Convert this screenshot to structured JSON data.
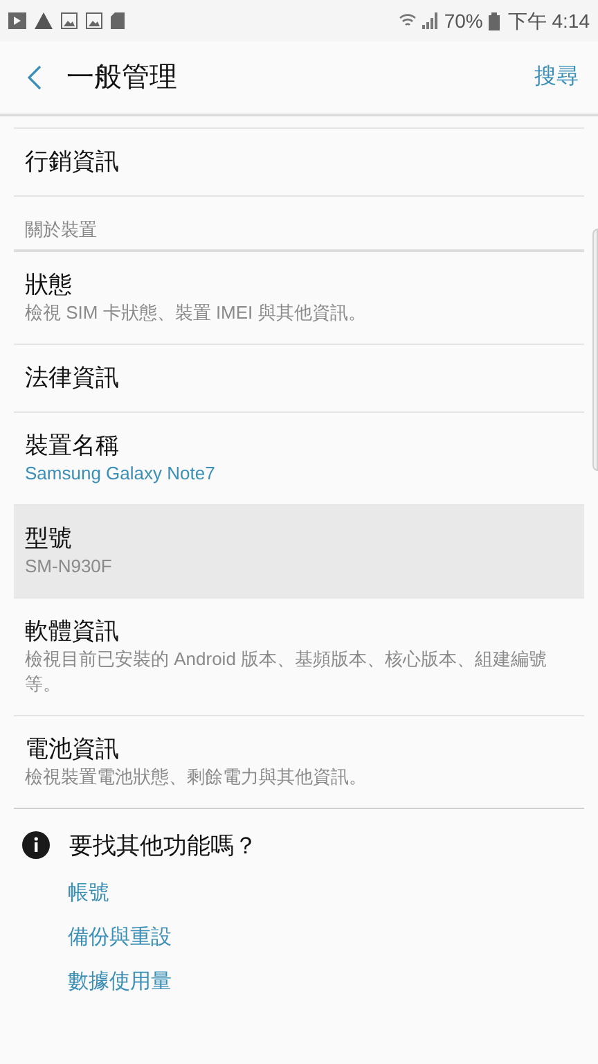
{
  "status_bar": {
    "battery": "70%",
    "time": "下午 4:14"
  },
  "header": {
    "title": "一般管理",
    "action": "搜尋"
  },
  "sections": [
    {
      "items": [
        {
          "title": "行銷資訊",
          "selected": false
        }
      ]
    },
    {
      "heading": "關於裝置",
      "items": [
        {
          "title": "狀態",
          "subtitle": "檢視 SIM 卡狀態、裝置 IMEI 與其他資訊。",
          "kind": "description",
          "selected": false
        },
        {
          "title": "法律資訊",
          "selected": false
        },
        {
          "title": "裝置名稱",
          "subtitle": "Samsung Galaxy Note7",
          "kind": "value",
          "selected": false
        },
        {
          "title": "型號",
          "subtitle": "SM-N930F",
          "kind": "description",
          "selected": true
        },
        {
          "title": "軟體資訊",
          "subtitle": "檢視目前已安裝的 Android 版本、基頻版本、核心版本、組建編號等。",
          "kind": "description",
          "selected": false
        },
        {
          "title": "電池資訊",
          "subtitle": "檢視裝置電池狀態、剩餘電力與其他資訊。",
          "kind": "description",
          "selected": false
        }
      ]
    }
  ],
  "suggestions": {
    "title": "要找其他功能嗎？",
    "links": [
      "帳號",
      "備份與重設",
      "數據使用量"
    ]
  }
}
